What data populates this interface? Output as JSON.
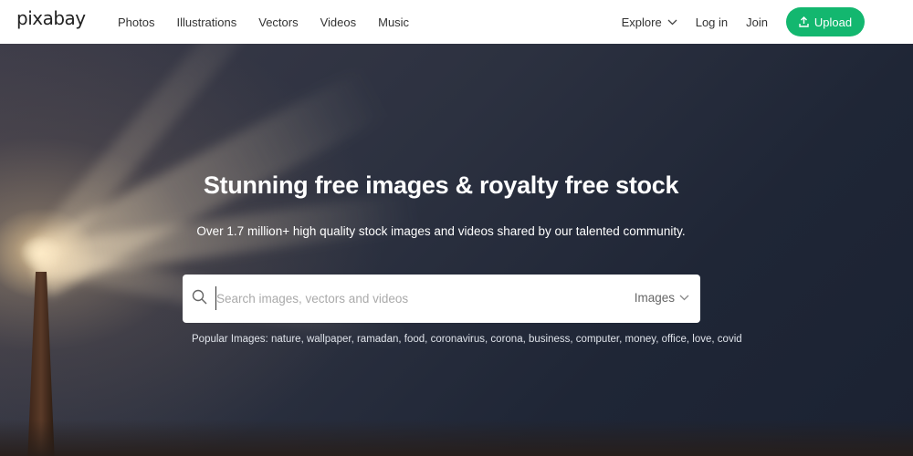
{
  "header": {
    "logo": "pixabay",
    "nav": [
      "Photos",
      "Illustrations",
      "Vectors",
      "Videos",
      "Music"
    ],
    "explore": "Explore",
    "login": "Log in",
    "join": "Join",
    "upload": "Upload",
    "accent_color": "#13b76f"
  },
  "hero": {
    "headline": "Stunning free images & royalty free stock",
    "subline": "Over 1.7 million+ high quality stock images and videos shared by our talented community.",
    "search": {
      "placeholder": "Search images, vectors and videos",
      "value": "",
      "type": "Images"
    },
    "popular_label": "Popular Images:",
    "popular_tags": [
      "nature",
      "wallpaper",
      "ramadan",
      "food",
      "coronavirus",
      "corona",
      "business",
      "computer",
      "money",
      "office",
      "love",
      "covid"
    ]
  }
}
